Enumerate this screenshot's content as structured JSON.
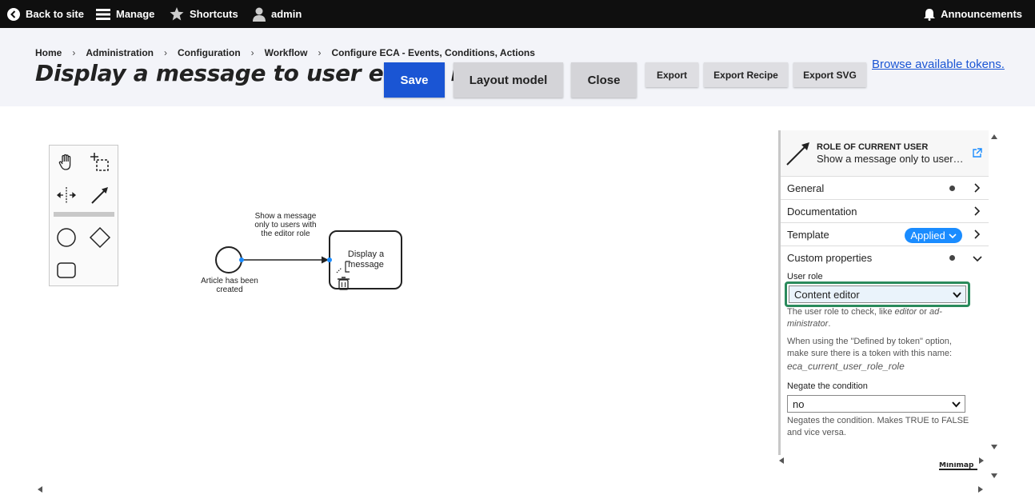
{
  "toolbar": {
    "back": "Back to site",
    "manage": "Manage",
    "shortcuts": "Shortcuts",
    "user": "admin",
    "announcements": "Announcements"
  },
  "breadcrumb": [
    "Home",
    "Administration",
    "Configuration",
    "Workflow",
    "Configure ECA - Events, Conditions, Actions"
  ],
  "title": "Display a message to user editor role",
  "buttons": {
    "save": "Save",
    "layout": "Layout model",
    "close": "Close",
    "export": "Export",
    "recipe": "Export Recipe",
    "svg": "Export SVG"
  },
  "tokens_link": "Browse available tokens.",
  "diagram": {
    "start_event_label": "Article has been created",
    "flow_label": "Show a message only to users with the editor role",
    "task_label": "Display a message"
  },
  "panel": {
    "element_type": "ROLE OF CURRENT USER",
    "element_name": "Show a message only to users with the editor role",
    "groups": {
      "general": "General",
      "documentation": "Documentation",
      "template": "Template",
      "template_badge": "Applied",
      "custom": "Custom properties"
    },
    "user_role_label": "User role",
    "user_role_value": "Content editor",
    "user_role_help_1a": "The user role to check, like ",
    "user_role_help_1b": "editor",
    "user_role_help_1c": " or ",
    "user_role_help_1d": "ad-ministrator",
    "user_role_help_1e": ".",
    "user_role_help_2": "When using the \"Defined by token\" option, make sure there is a token with this name:",
    "user_role_help_3": "eca_current_user_role_role",
    "negate_label": "Negate the condition",
    "negate_value": "no",
    "negate_help": "Negates the condition. Makes TRUE to FALSE and vice versa."
  },
  "minimap": "Minimap",
  "colors": {
    "toolbar_bg": "#0f0f0f",
    "header_bg": "#f3f4f9",
    "primary": "#1a55d4",
    "applied_badge": "#1a8cff",
    "focus_ring": "#2a8a5c",
    "flow_dot": "#1a8cff"
  },
  "icons": {
    "back": "back-arrow-icon",
    "manage": "hamburger-icon",
    "shortcuts": "star-icon",
    "user": "person-icon",
    "announcements": "bell-icon"
  }
}
